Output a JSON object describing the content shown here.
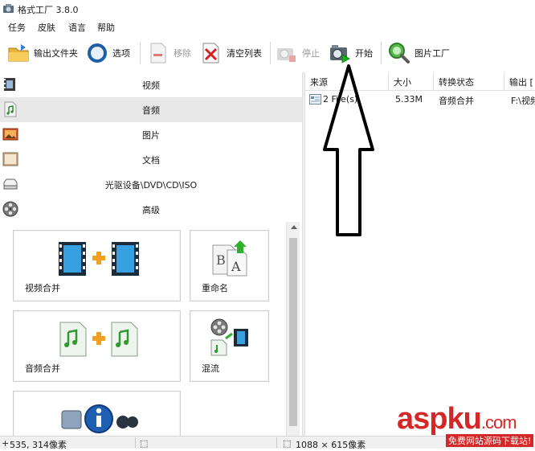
{
  "window": {
    "title": "格式工厂 3.8.0"
  },
  "menu": [
    "任务",
    "皮肤",
    "语言",
    "帮助"
  ],
  "toolbar": {
    "output_folder": "输出文件夹",
    "options": "选项",
    "remove": "移除",
    "clear_list": "清空列表",
    "stop": "停止",
    "start": "开始",
    "picture_factory": "图片工厂"
  },
  "categories": [
    {
      "label": "视频",
      "icon": "film-icon"
    },
    {
      "label": "音频",
      "icon": "audio-icon"
    },
    {
      "label": "图片",
      "icon": "picture-icon"
    },
    {
      "label": "文档",
      "icon": "document-icon"
    },
    {
      "label": "光驱设备\\DVD\\CD\\ISO",
      "icon": "disc-drive-icon"
    },
    {
      "label": "高级",
      "icon": "film-reel-icon"
    }
  ],
  "active_category": "音频",
  "tools": [
    {
      "label": "视频合并",
      "icon": "video-merge-icon"
    },
    {
      "label": "重命名",
      "icon": "rename-icon"
    },
    {
      "label": "音频合并",
      "icon": "audio-merge-icon"
    },
    {
      "label": "混流",
      "icon": "mux-icon"
    },
    {
      "label": "",
      "icon": "media-info-icon"
    }
  ],
  "list": {
    "headers": [
      "来源",
      "大小",
      "转换状态",
      "输出 ["
    ],
    "rows": [
      {
        "source": "2 File(s)",
        "size": "5.33M",
        "status": "音频合并",
        "output": "F:\\视频"
      }
    ]
  },
  "status": {
    "cursor": "535, 314像素",
    "selection": "1088 × 615像素"
  },
  "watermark": {
    "main_a": "asp",
    "main_b": "ku",
    "main_c": ".com",
    "sub": "免费网站源码下载站!"
  },
  "colors": {
    "accent_red": "#d42727",
    "active_row": "#e8e8e8"
  }
}
